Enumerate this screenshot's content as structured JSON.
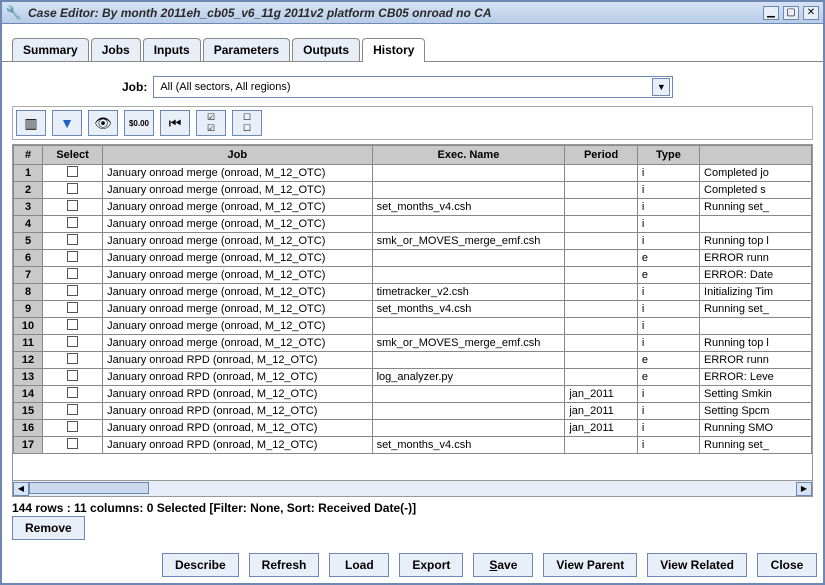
{
  "window": {
    "title": "Case Editor: By month 2011eh_cb05_v6_11g 2011v2 platform CB05 onroad no CA",
    "icon": "🔧"
  },
  "tabs": [
    "Summary",
    "Jobs",
    "Inputs",
    "Parameters",
    "Outputs",
    "History"
  ],
  "active_tab": 5,
  "job_filter": {
    "label": "Job:",
    "selected": "All (All sectors, All regions)"
  },
  "toolbar": {
    "columns_icon": "columns",
    "filter_icon": "filter",
    "view_icon": "view",
    "format_icon": "$0.00",
    "first_icon": "first",
    "select_icon": "select",
    "clear_icon": "clear"
  },
  "columns": [
    "#",
    "Select",
    "Job",
    "Exec. Name",
    "Period",
    "Type",
    ""
  ],
  "rows": [
    {
      "n": 1,
      "job": "January onroad merge (onroad, M_12_OTC)",
      "exec": "",
      "period": "",
      "type": "i",
      "rest": "Completed jo"
    },
    {
      "n": 2,
      "job": "January onroad merge (onroad, M_12_OTC)",
      "exec": "",
      "period": "",
      "type": "i",
      "rest": "Completed s"
    },
    {
      "n": 3,
      "job": "January onroad merge (onroad, M_12_OTC)",
      "exec": "set_months_v4.csh",
      "period": "",
      "type": "i",
      "rest": "Running set_"
    },
    {
      "n": 4,
      "job": "January onroad merge (onroad, M_12_OTC)",
      "exec": "",
      "period": "",
      "type": "i",
      "rest": ""
    },
    {
      "n": 5,
      "job": "January onroad merge (onroad, M_12_OTC)",
      "exec": "smk_or_MOVES_merge_emf.csh",
      "period": "",
      "type": "i",
      "rest": "Running top l"
    },
    {
      "n": 6,
      "job": "January onroad merge (onroad, M_12_OTC)",
      "exec": "",
      "period": "",
      "type": "e",
      "rest": "ERROR runn"
    },
    {
      "n": 7,
      "job": "January onroad merge (onroad, M_12_OTC)",
      "exec": "",
      "period": "",
      "type": "e",
      "rest": "ERROR: Date"
    },
    {
      "n": 8,
      "job": "January onroad merge (onroad, M_12_OTC)",
      "exec": "timetracker_v2.csh",
      "period": "",
      "type": "i",
      "rest": "Initializing Tim"
    },
    {
      "n": 9,
      "job": "January onroad merge (onroad, M_12_OTC)",
      "exec": "set_months_v4.csh",
      "period": "",
      "type": "i",
      "rest": "Running set_"
    },
    {
      "n": 10,
      "job": "January onroad merge (onroad, M_12_OTC)",
      "exec": "",
      "period": "",
      "type": "i",
      "rest": ""
    },
    {
      "n": 11,
      "job": "January onroad merge (onroad, M_12_OTC)",
      "exec": "smk_or_MOVES_merge_emf.csh",
      "period": "",
      "type": "i",
      "rest": "Running top l"
    },
    {
      "n": 12,
      "job": "January onroad RPD (onroad, M_12_OTC)",
      "exec": "",
      "period": "",
      "type": "e",
      "rest": "ERROR runn"
    },
    {
      "n": 13,
      "job": "January onroad RPD (onroad, M_12_OTC)",
      "exec": "log_analyzer.py",
      "period": "",
      "type": "e",
      "rest": "ERROR: Leve"
    },
    {
      "n": 14,
      "job": "January onroad RPD (onroad, M_12_OTC)",
      "exec": "",
      "period": "jan_2011",
      "type": "i",
      "rest": "Setting Smkin"
    },
    {
      "n": 15,
      "job": "January onroad RPD (onroad, M_12_OTC)",
      "exec": "",
      "period": "jan_2011",
      "type": "i",
      "rest": "Setting Spcm"
    },
    {
      "n": 16,
      "job": "January onroad RPD (onroad, M_12_OTC)",
      "exec": "",
      "period": "jan_2011",
      "type": "i",
      "rest": "Running SMO"
    },
    {
      "n": 17,
      "job": "January onroad RPD (onroad, M_12_OTC)",
      "exec": "set_months_v4.csh",
      "period": "",
      "type": "i",
      "rest": "Running set_"
    }
  ],
  "status_line": "144 rows : 11 columns: 0 Selected [Filter: None, Sort: Received Date(-)]",
  "buttons": {
    "remove": "Remove",
    "describe": "Describe",
    "refresh": "Refresh",
    "load": "Load",
    "export": "Export",
    "save": "Save",
    "save_mnemonic": "S",
    "view_parent": "View Parent",
    "view_related": "View Related",
    "close": "Close"
  }
}
